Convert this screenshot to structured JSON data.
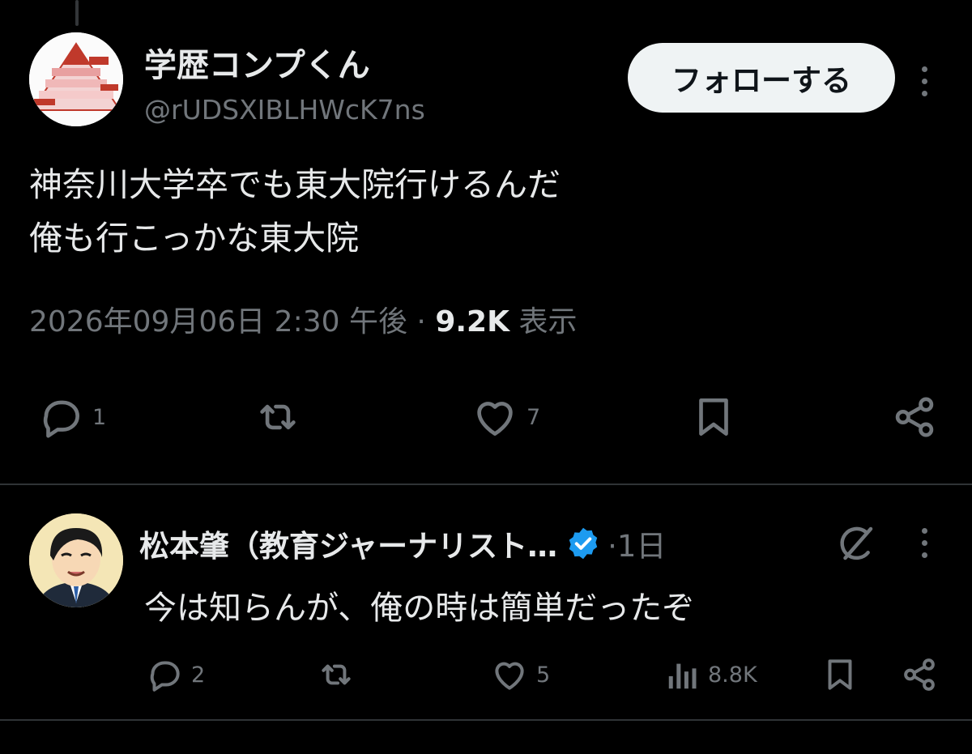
{
  "tweet": {
    "author_name": "学歴コンプくん",
    "author_handle": "@rUDSXIBLHWcK7ns",
    "follow_label": "フォローする",
    "text_line1": "神奈川大学卒でも東大院行けるんだ",
    "text_line2": "俺も行こっかな東大院",
    "date": "2026年09月06日 2:30 午後 ·",
    "views_count": "9.2K",
    "views_label": "表示",
    "reply_count": "1",
    "like_count": "7",
    "icons": [
      "reply-icon",
      "retweet-icon",
      "like-icon",
      "bookmark-icon",
      "share-icon",
      "more-icon"
    ]
  },
  "reply": {
    "author_name": "松本肇（教育ジャーナリスト…",
    "time": "·1日",
    "text": "今は知らんが、俺の時は簡単だったぞ",
    "reply_count": "2",
    "like_count": "5",
    "view_count": "8.8K",
    "icons": [
      "reply-icon",
      "retweet-icon",
      "like-icon",
      "views-icon",
      "bookmark-icon",
      "share-icon",
      "verified-badge-icon",
      "grok-icon",
      "more-icon"
    ]
  },
  "colors": {
    "background": "#000000",
    "text": "#e7e9ea",
    "muted": "#71767b",
    "verified": "#1d9bf0",
    "follow_bg": "#eff3f4"
  }
}
